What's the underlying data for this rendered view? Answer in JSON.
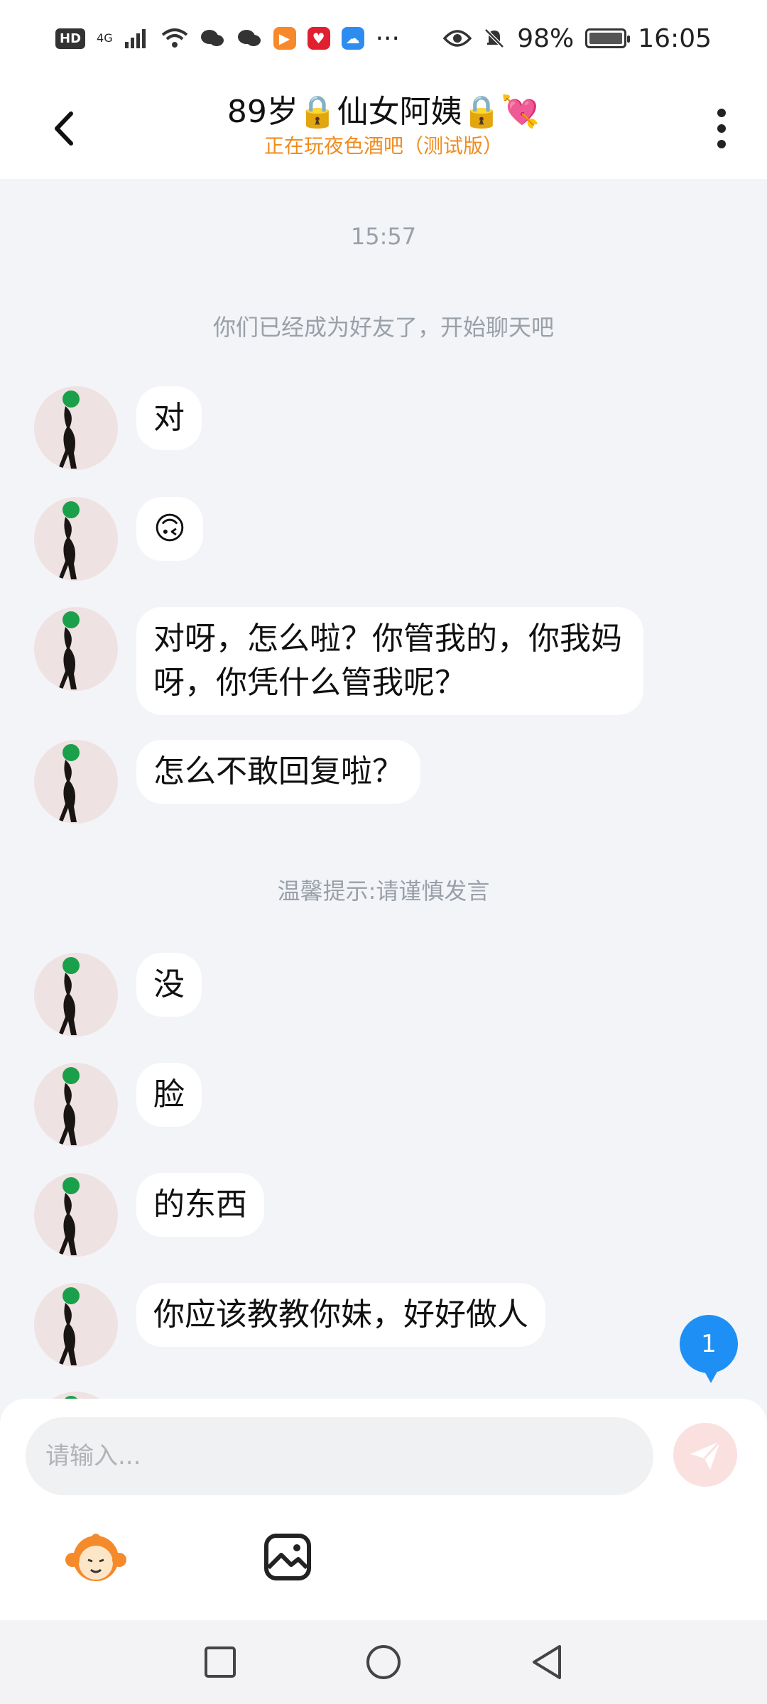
{
  "status_bar": {
    "network": "4G",
    "battery": "98%",
    "time": "16:05",
    "more": "···"
  },
  "header": {
    "title": "89岁🔒仙女阿姨🔒💘",
    "subtitle": "正在玩夜色酒吧（测试版）"
  },
  "chat": {
    "timestamp": "15:57",
    "friend_notice": "你们已经成为好友了，开始聊天吧",
    "tip": "温馨提示:请谨慎发言",
    "messages": [
      {
        "text": "对"
      },
      {
        "text": "🙃"
      },
      {
        "text": "对呀，怎么啦？你管我的，你我妈呀，你凭什么管我呢？"
      },
      {
        "text": "怎么不敢回复啦？"
      },
      {
        "text": "没"
      },
      {
        "text": "脸"
      },
      {
        "text": "的东西"
      },
      {
        "text": "你应该教教你妹，好好做人"
      }
    ]
  },
  "unread_badge": "1",
  "input": {
    "placeholder": "请输入..."
  },
  "colors": {
    "subtitle": "#f08c1e",
    "badge": "#1e90f5",
    "send_inactive": "#fbe0e0"
  },
  "icons": [
    "back-icon",
    "more-vert-icon",
    "send-icon",
    "emoji-mascot-icon",
    "image-icon",
    "nav-recent-icon",
    "nav-home-icon",
    "nav-back-icon"
  ]
}
